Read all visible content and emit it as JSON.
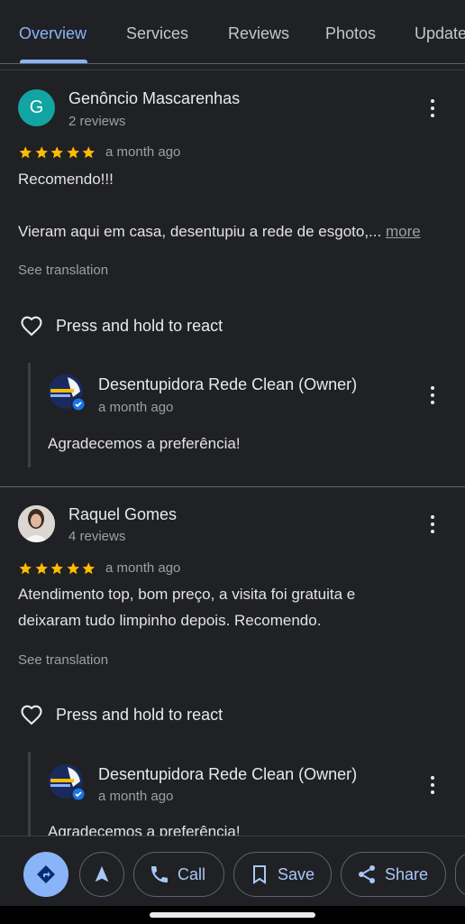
{
  "tabs": [
    {
      "label": "Overview",
      "active": true
    },
    {
      "label": "Services",
      "active": false
    },
    {
      "label": "Reviews",
      "active": false
    },
    {
      "label": "Photos",
      "active": false
    },
    {
      "label": "Updates",
      "active": false
    }
  ],
  "reviews": [
    {
      "author": "Genôncio Mascarenhas",
      "avatar_letter": "G",
      "reviews_count": "2 reviews",
      "rating": 5,
      "time": "a month ago",
      "text_line1": "Recomendo!!!",
      "text_line2": "Vieram aqui em casa, desentupiu a rede de esgoto,...",
      "more_label": "more",
      "translate_label": "See translation",
      "react_label": "Press and hold to react",
      "owner_reply": {
        "name": "Desentupidora Rede Clean (Owner)",
        "time": "a month ago",
        "text": "Agradecemos a preferência!"
      }
    },
    {
      "author": "Raquel Gomes",
      "reviews_count": "4 reviews",
      "rating": 5,
      "time": "a month ago",
      "text_line1": "Atendimento top, bom preço, a visita foi gratuita e",
      "text_line2": "deixaram tudo limpinho depois. Recomendo.",
      "translate_label": "See translation",
      "react_label": "Press and hold to react",
      "owner_reply": {
        "name": "Desentupidora Rede Clean (Owner)",
        "time": "a month ago",
        "text": "Agradecemos a preferência!"
      }
    }
  ],
  "actions": {
    "directions_icon": "directions-icon",
    "start_icon": "navigation-arrow-icon",
    "call_label": "Call",
    "save_label": "Save",
    "share_label": "Share"
  },
  "colors": {
    "background": "#202124",
    "accent": "#8ab4f8",
    "star": "#fbbc04",
    "avatar_g": "#12a4a2"
  }
}
